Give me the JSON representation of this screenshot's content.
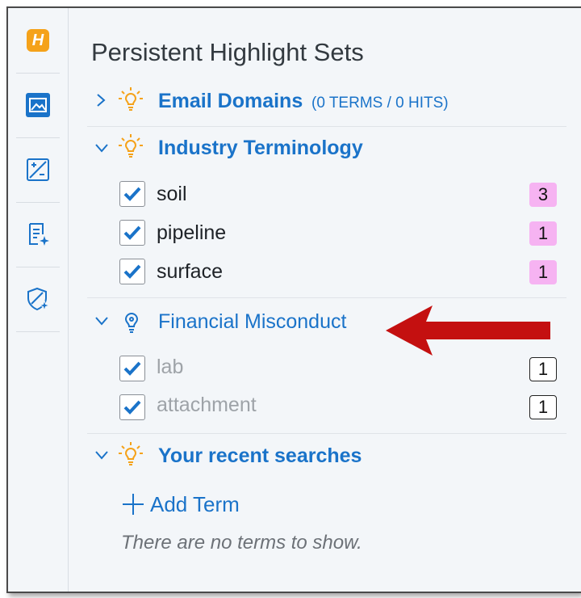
{
  "panel": {
    "title": "Persistent Highlight Sets"
  },
  "rail": {
    "items": [
      {
        "icon": "highlight-logo-icon",
        "label": "H"
      },
      {
        "icon": "image-icon"
      },
      {
        "icon": "image-edit-icon"
      },
      {
        "icon": "document-sparkle-icon"
      },
      {
        "icon": "shield-sparkle-icon"
      }
    ]
  },
  "sets": [
    {
      "name": "Email Domains",
      "meta": "(0 TERMS / 0 HITS)",
      "expanded": false,
      "terms": []
    },
    {
      "name": "Industry Terminology",
      "expanded": true,
      "terms": [
        {
          "label": "soil",
          "count": "3"
        },
        {
          "label": "pipeline",
          "count": "1"
        },
        {
          "label": "surface",
          "count": "1"
        }
      ]
    },
    {
      "name": "Financial Misconduct",
      "expanded": true,
      "disabled": true,
      "terms": [
        {
          "label": "lab",
          "count": "1"
        },
        {
          "label": "attachment",
          "count": "1"
        }
      ]
    },
    {
      "name": "Your recent searches",
      "expanded": true,
      "terms": []
    }
  ],
  "recent": {
    "add_term_label": "Add Term",
    "empty_message": "There are no terms to show."
  },
  "colors": {
    "accent": "#1a73c9",
    "bulb": "#f5a21a",
    "hit_badge": "#f6b3f2",
    "annotation_arrow": "#c41010"
  }
}
